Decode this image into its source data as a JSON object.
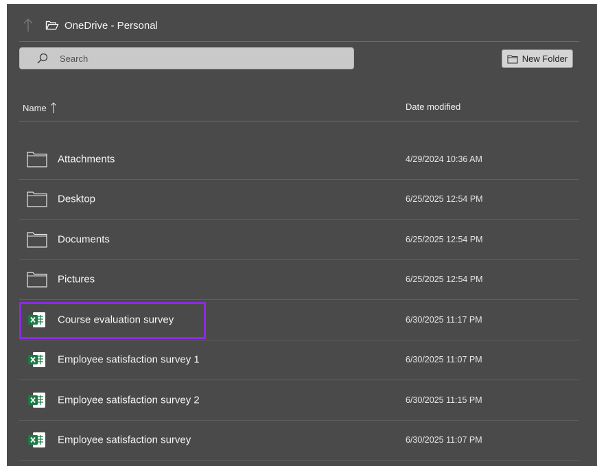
{
  "header": {
    "location_label": "OneDrive - Personal",
    "up_icon": "up-arrow-icon",
    "location_icon": "open-folder-icon"
  },
  "search": {
    "placeholder": "Search",
    "icon": "search-icon"
  },
  "toolbar": {
    "new_folder_label": "New Folder",
    "new_folder_icon": "folder-icon"
  },
  "columns": {
    "name": "Name",
    "date": "Date modified",
    "sort_icon": "sort-ascending-arrow-icon"
  },
  "rows": [
    {
      "name": "Attachments",
      "date": "4/29/2024 10:36 AM",
      "type": "folder"
    },
    {
      "name": "Desktop",
      "date": "6/25/2025 12:54 PM",
      "type": "folder"
    },
    {
      "name": "Documents",
      "date": "6/25/2025 12:54 PM",
      "type": "folder"
    },
    {
      "name": "Pictures",
      "date": "6/25/2025 12:54 PM",
      "type": "folder"
    },
    {
      "name": "Course evaluation survey",
      "date": "6/30/2025 11:17 PM",
      "type": "excel",
      "highlighted": true
    },
    {
      "name": "Employee satisfaction survey 1",
      "date": "6/30/2025 11:07 PM",
      "type": "excel"
    },
    {
      "name": "Employee satisfaction survey 2",
      "date": "6/30/2025 11:15 PM",
      "type": "excel"
    },
    {
      "name": "Employee satisfaction survey",
      "date": "6/30/2025 11:07 PM",
      "type": "excel"
    }
  ],
  "colors": {
    "background": "#4a4a4a",
    "highlight": "#8a2be2",
    "excel_green": "#1d7a45"
  }
}
